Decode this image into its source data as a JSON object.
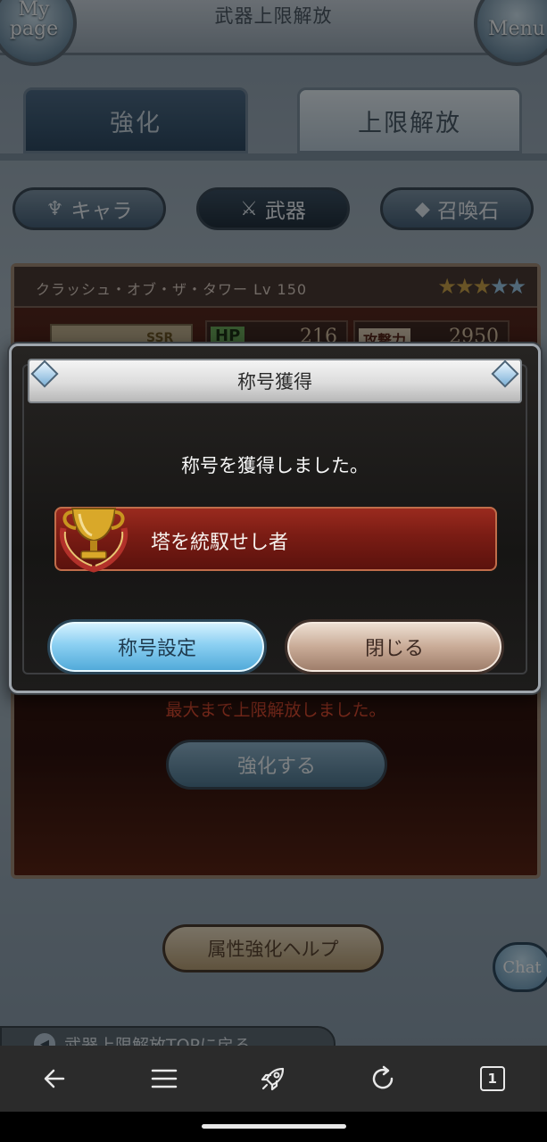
{
  "header": {
    "title": "武器上限解放",
    "mypage_label_1": "My",
    "mypage_label_2": "page",
    "menu_label": "Menu"
  },
  "tabs": [
    {
      "label": "強化",
      "active": false
    },
    {
      "label": "上限解放",
      "active": true
    }
  ],
  "categories": [
    {
      "label": "キャラ"
    },
    {
      "label": "武器"
    },
    {
      "label": "召喚石"
    }
  ],
  "weapon": {
    "name": "クラッシュ・オブ・ザ・タワー Lv 150",
    "rarity": "SSR",
    "stars_filled": 3,
    "stars_total": 5,
    "hp_label": "HP",
    "hp_value": "216",
    "atk_label": "攻撃力",
    "atk_value": "2950"
  },
  "panel": {
    "max_message": "最大まで上限解放しました。",
    "enhance_button": "強化する"
  },
  "dialog": {
    "title": "称号獲得",
    "message": "称号を獲得しました。",
    "earned_title": "塔を統馭せし者",
    "primary_button": "称号設定",
    "close_button": "閉じる"
  },
  "footer": {
    "help_button": "属性強化ヘルプ",
    "chat_button": "Chat",
    "back_link": "武器上限解放TOPに戻る"
  },
  "browser": {
    "tab_count": "1"
  },
  "colors": {
    "accent_blue": "#4ea8d8",
    "banner_red": "#7a1c14",
    "warning_text": "#e04d32"
  }
}
